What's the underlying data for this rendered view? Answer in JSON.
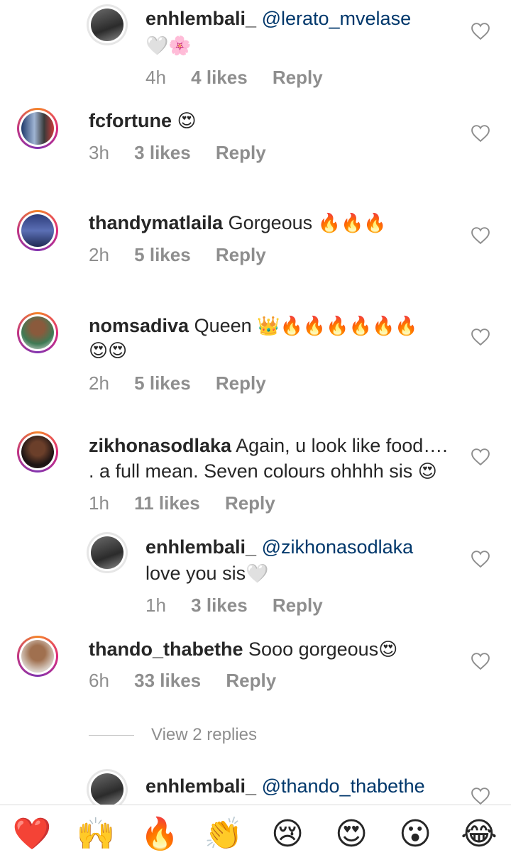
{
  "comments": [
    {
      "user": "enhlembali_",
      "mention": "@lerato_mvelase",
      "text": "",
      "emoji": "🤍🌸",
      "time": "4h",
      "likes": "4 likes",
      "reply": "Reply",
      "is_reply": true
    },
    {
      "user": "fcfortune",
      "mention": "",
      "text": "",
      "emoji": "😍",
      "time": "3h",
      "likes": "3 likes",
      "reply": "Reply",
      "is_reply": false
    },
    {
      "user": "thandymatlaila",
      "mention": "",
      "text": "Gorgeous",
      "emoji": "🔥🔥🔥",
      "time": "2h",
      "likes": "5 likes",
      "reply": "Reply",
      "is_reply": false
    },
    {
      "user": "nomsadiva",
      "mention": "",
      "text": "Queen",
      "emoji": "👑🔥🔥🔥🔥🔥🔥",
      "emoji2": "😍😍",
      "time": "2h",
      "likes": "5 likes",
      "reply": "Reply",
      "is_reply": false
    },
    {
      "user": "zikhonasodlaka",
      "mention": "",
      "text": "Again, u look like food….",
      "text2": ". a full mean. Seven colours ohhhh sis",
      "emoji": "😍",
      "time": "1h",
      "likes": "11 likes",
      "reply": "Reply",
      "is_reply": false
    },
    {
      "user": "enhlembali_",
      "mention": "@zikhonasodlaka",
      "text": "love you sis",
      "emoji": "🤍",
      "time": "1h",
      "likes": "3 likes",
      "reply": "Reply",
      "is_reply": true
    },
    {
      "user": "thando_thabethe",
      "mention": "",
      "text": "Sooo gorgeous",
      "emoji": "😍",
      "time": "6h",
      "likes": "33 likes",
      "reply": "Reply",
      "is_reply": false
    },
    {
      "user": "enhlembali_",
      "mention": "@thando_thabethe",
      "text": "",
      "emoji": "",
      "time": "",
      "likes": "",
      "reply": "",
      "is_reply": true
    }
  ],
  "view_replies": "View 2 replies",
  "emoji_bar": [
    "❤️",
    "🙌",
    "🔥",
    "👏",
    "😢",
    "😍",
    "😮",
    "😂"
  ],
  "colors": {
    "text": "#262626",
    "meta": "#8e8e8e",
    "mention": "#00376b",
    "ring_start": "#f58529",
    "ring_end": "#8134af"
  },
  "icons": {
    "like": "heart-outline-icon"
  }
}
